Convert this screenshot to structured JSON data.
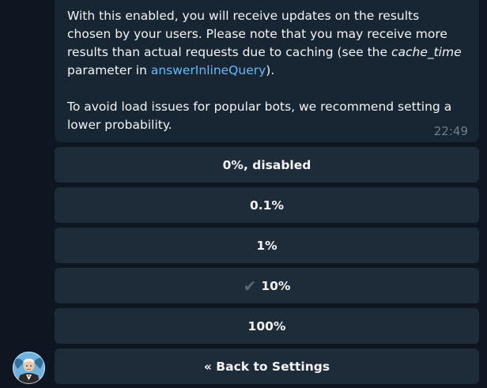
{
  "message": {
    "paragraph1_part1": "With this enabled, you will receive updates on the results chosen by your users. Please note that you may receive more results than actual requests due to caching (see the ",
    "paragraph1_em": "cache_time",
    "paragraph1_part2": " parameter in ",
    "paragraph1_link": "answerInlineQuery",
    "paragraph1_end": ").",
    "paragraph2": "To avoid load issues for popular bots, we recommend setting a lower probability.",
    "time": "22:49"
  },
  "keyboard": {
    "options": [
      {
        "label": "0%, disabled",
        "selected": false
      },
      {
        "label": "0.1%",
        "selected": false
      },
      {
        "label": "1%",
        "selected": false
      },
      {
        "label": "10%",
        "selected": true,
        "check": "✔"
      },
      {
        "label": "100%",
        "selected": false
      }
    ],
    "back_label": "« Back to Settings"
  },
  "colors": {
    "background": "#0e1621",
    "bubble": "#182533",
    "button": "#1e2c3a",
    "link": "#62bcf9",
    "time": "#6d7f8f"
  }
}
